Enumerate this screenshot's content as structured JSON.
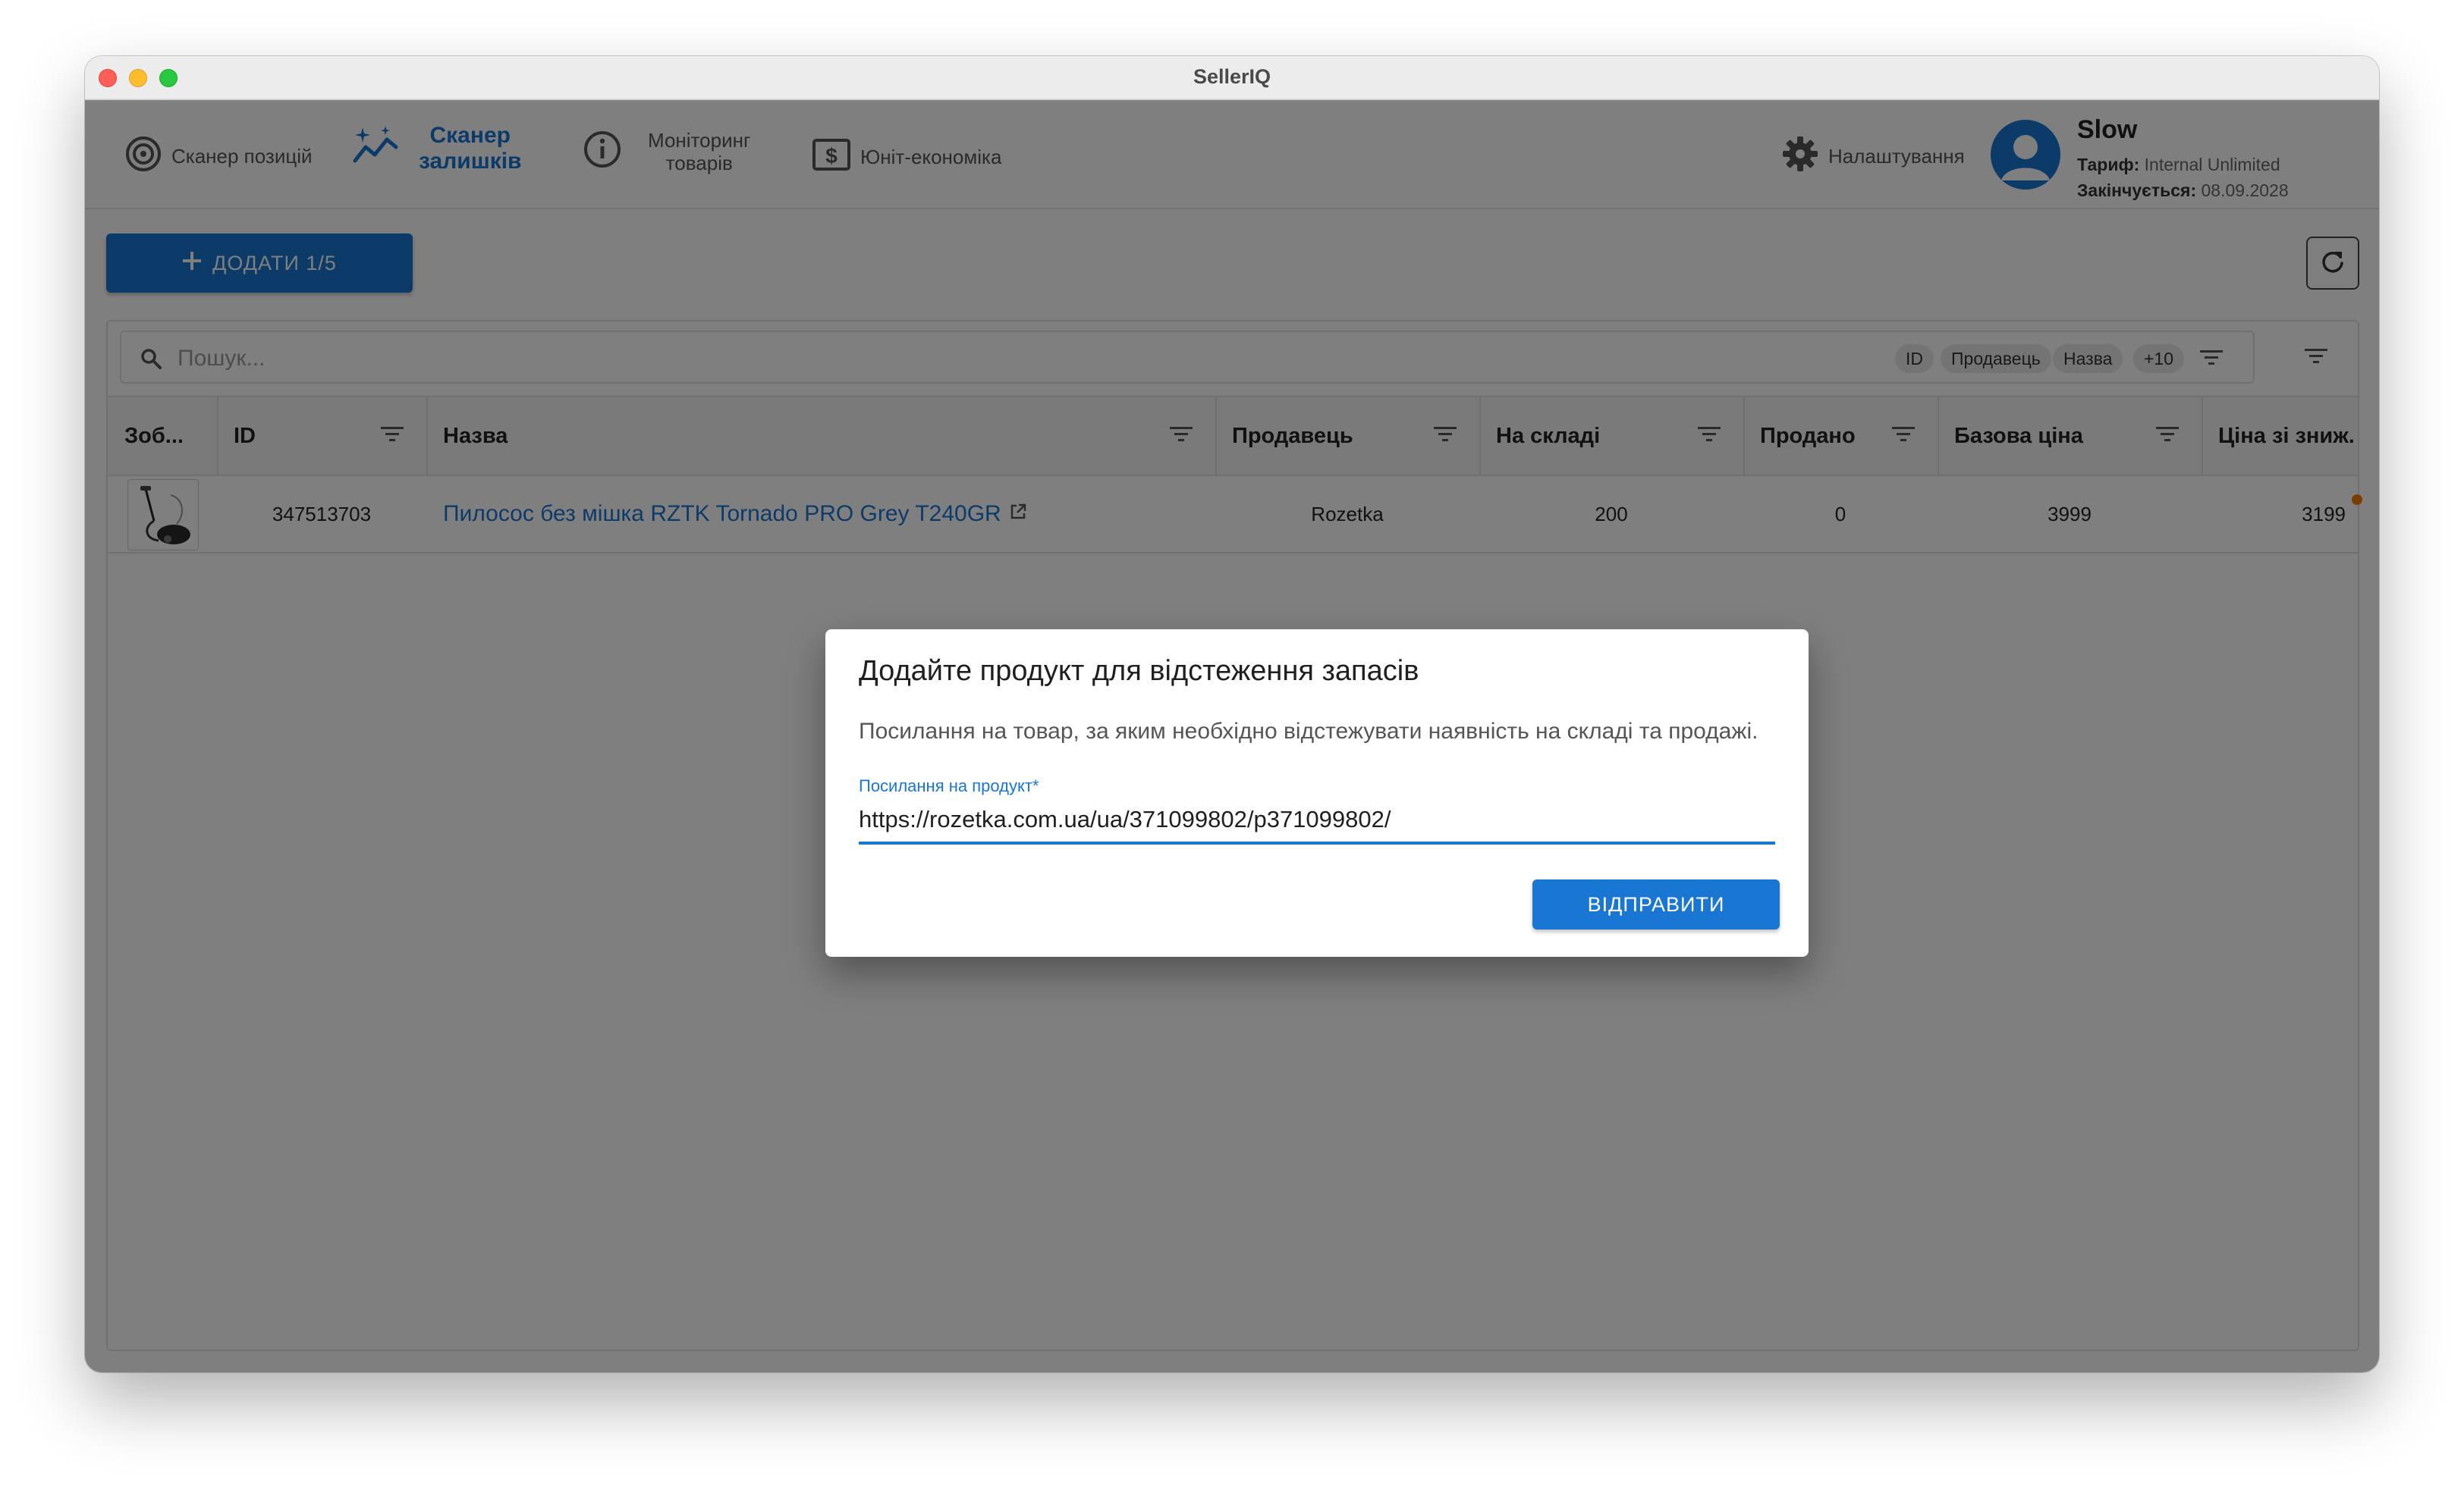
{
  "window": {
    "title": "SellerIQ"
  },
  "nav": {
    "items": [
      {
        "label": "Сканер позицій",
        "icon": "target-icon"
      },
      {
        "label_line1": "Сканер",
        "label_line2": "залишків",
        "icon": "sparkles-chart-icon",
        "active": true
      },
      {
        "label_line1": "Моніторинг",
        "label_line2": "товарів",
        "icon": "info-icon"
      },
      {
        "label": "Юніт-економіка",
        "icon": "dollar-box-icon"
      }
    ],
    "settings_label": "Налаштування"
  },
  "user": {
    "name": "Slow",
    "plan_label": "Тариф:",
    "plan_value": "Internal Unlimited",
    "expires_label": "Закінчується:",
    "expires_value": "08.09.2028"
  },
  "toolbar": {
    "add_label": "ДОДАТИ 1/5"
  },
  "search": {
    "placeholder": "Пошук...",
    "chips": [
      "ID",
      "Продавець",
      "Назва",
      "+10"
    ]
  },
  "table": {
    "columns": [
      "Зоб...",
      "ID",
      "Назва",
      "Продавець",
      "На складі",
      "Продано",
      "Базова ціна",
      "Ціна зі зниж."
    ],
    "rows": [
      {
        "id": "347513703",
        "name": "Пилосос без мішка RZTK Tornado PRO Grey T240GR",
        "seller": "Rozetka",
        "stock": "200",
        "sold": "0",
        "base_price": "3999",
        "discount_price": "3199"
      }
    ]
  },
  "dialog": {
    "title": "Додайте продукт для відстеження запасів",
    "description": "Посилання на товар, за яким необхідно відстежувати наявність на складі та продажі.",
    "field_label": "Посилання на продукт",
    "field_required": "*",
    "field_value": "https://rozetka.com.ua/ua/371099802/p371099802/",
    "submit_label": "ВІДПРАВИТИ"
  },
  "colors": {
    "accent": "#1976d2",
    "scrim": "rgba(0,0,0,0.5)",
    "badge": "#f57c00"
  }
}
